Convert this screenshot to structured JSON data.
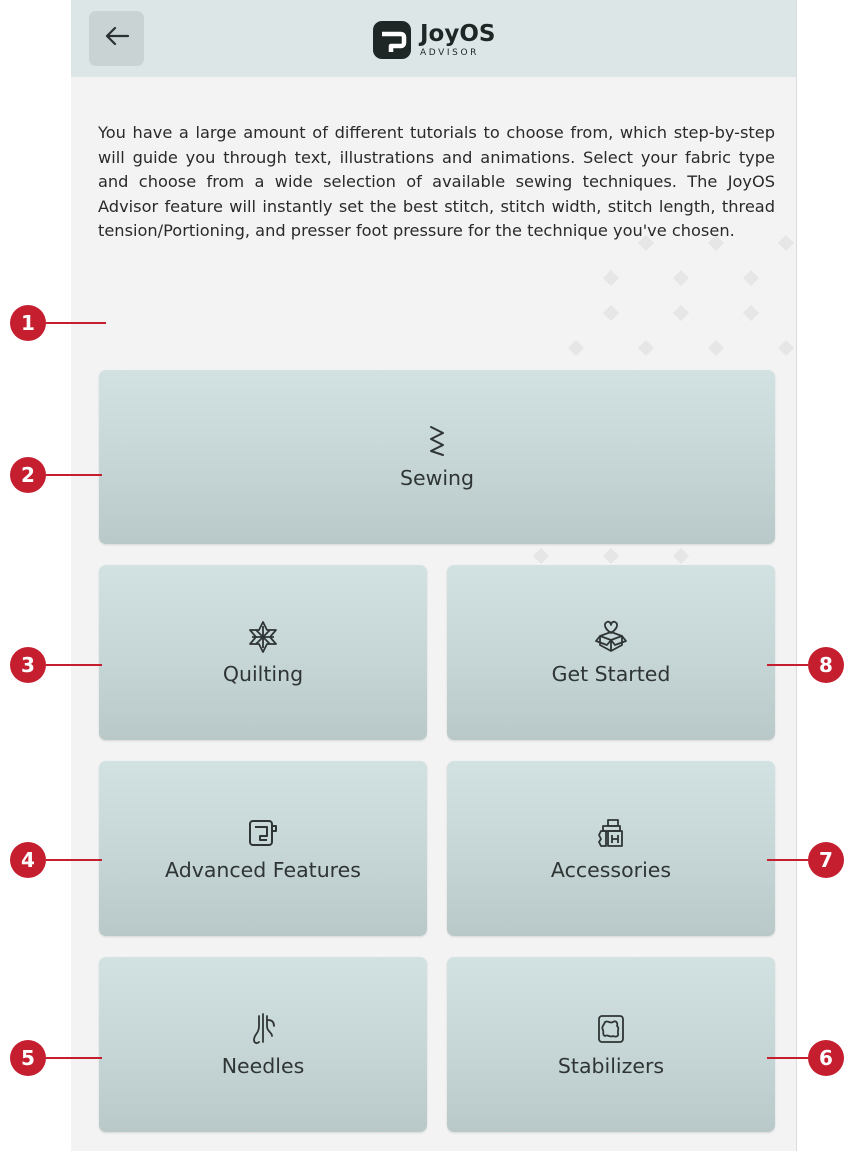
{
  "header": {
    "back_icon": "arrow-left-icon",
    "logo_name": "JoyOS",
    "logo_sub": "ADVISOR"
  },
  "intro_text": "You have a large amount of different tutorials to choose from, which step-by-step will guide you through text, illustrations and animations. Select your fabric type and choose from a wide selection of available sewing techniques. The JoyOS Advisor feature will instantly set the best stitch, stitch width, stitch length, thread tension/Portioning, and presser foot pressure for the technique you've chosen.",
  "tiles": {
    "sewing": {
      "label": "Sewing",
      "icon": "zigzag-stitch-icon"
    },
    "quilting": {
      "label": "Quilting",
      "icon": "quilt-star-icon"
    },
    "get_started": {
      "label": "Get Started",
      "icon": "gift-box-heart-icon"
    },
    "advanced_features": {
      "label": "Advanced Features",
      "icon": "sewing-machine-icon"
    },
    "accessories": {
      "label": "Accessories",
      "icon": "presser-foot-icon"
    },
    "needles": {
      "label": "Needles",
      "icon": "needle-icon"
    },
    "stabilizers": {
      "label": "Stabilizers",
      "icon": "stabilizer-patch-icon"
    }
  },
  "callouts": [
    "1",
    "2",
    "3",
    "4",
    "5",
    "6",
    "7",
    "8"
  ],
  "colors": {
    "callout": "#c41e2f",
    "header_bg": "#dde6e6",
    "tile_bg": "#cddcdc",
    "screen_bg": "#f3f3f3"
  }
}
